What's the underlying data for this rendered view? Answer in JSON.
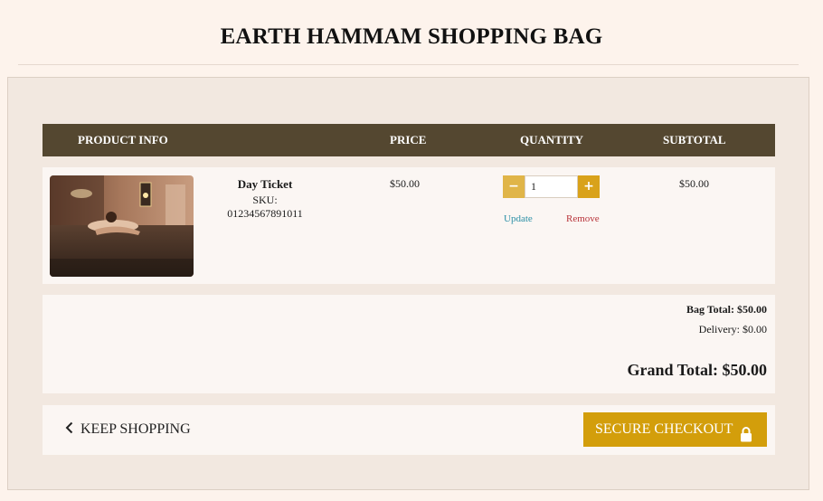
{
  "page": {
    "title": "EARTH HAMMAM SHOPPING BAG"
  },
  "table": {
    "headers": {
      "product": "PRODUCT INFO",
      "price": "PRICE",
      "quantity": "QUANTITY",
      "subtotal": "SUBTOTAL"
    }
  },
  "item": {
    "name": "Day Ticket",
    "sku": "SKU: 01234567891011",
    "price": "$50.00",
    "quantity": "1",
    "minus_symbol": "−",
    "plus_symbol": "+",
    "update_label": "Update",
    "remove_label": "Remove",
    "subtotal": "$50.00"
  },
  "totals": {
    "bag_total_label": "Bag Total:",
    "bag_total_value": "$50.00",
    "delivery_label": "Delivery:",
    "delivery_value": "$0.00",
    "grand_total_label": "Grand Total:",
    "grand_total_value": "$50.00"
  },
  "actions": {
    "keep_shopping_label": "KEEP SHOPPING",
    "checkout_label": "SECURE CHECKOUT"
  },
  "icons": {
    "keep_shopping": "chevron-left-icon",
    "checkout": "lock-icon"
  },
  "colors": {
    "header_bg": "#544730",
    "accent": "#d39e0b",
    "update_link": "#2b8fa6",
    "remove_link": "#b8343a"
  }
}
